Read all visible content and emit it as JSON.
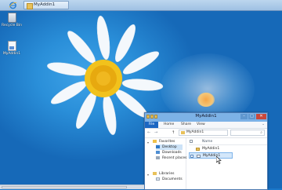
{
  "taskbar": {
    "ie_icon": "internet-explorer-icon",
    "app_title": "MyAddin1"
  },
  "desktop": {
    "icons": [
      {
        "label": "Recycle Bin",
        "icon": "recycle-bin-icon"
      },
      {
        "label": "MyAddin1",
        "icon": "document-icon"
      }
    ]
  },
  "window": {
    "title": "MyAddin1",
    "buttons": {
      "minimize": "–",
      "maximize": "□",
      "close": "✕"
    },
    "ribbon_tabs": [
      "File",
      "Home",
      "Share",
      "View"
    ],
    "ribbon_expand": "⌄",
    "nav": {
      "back": "←",
      "forward": "→",
      "up": "↑"
    },
    "address": "MyAddin1",
    "search_icon": "⌕",
    "sidebar": {
      "favorites": "Favorites",
      "items": [
        "Desktop",
        "Downloads",
        "Recent places"
      ],
      "libraries": "Libraries",
      "library_items": [
        "Documents"
      ]
    },
    "column_header": "Name",
    "files": [
      {
        "name": "MyAddin1",
        "type": "folder"
      },
      {
        "name": "MyAddin1",
        "type": "file",
        "selected": true
      }
    ]
  },
  "colors": {
    "desktop_bg": "#1a77c9",
    "titlebar": "#7db2e6",
    "file_tab": "#1c67c2",
    "close_button": "#c9483b",
    "selection": "#d4e7fa"
  }
}
